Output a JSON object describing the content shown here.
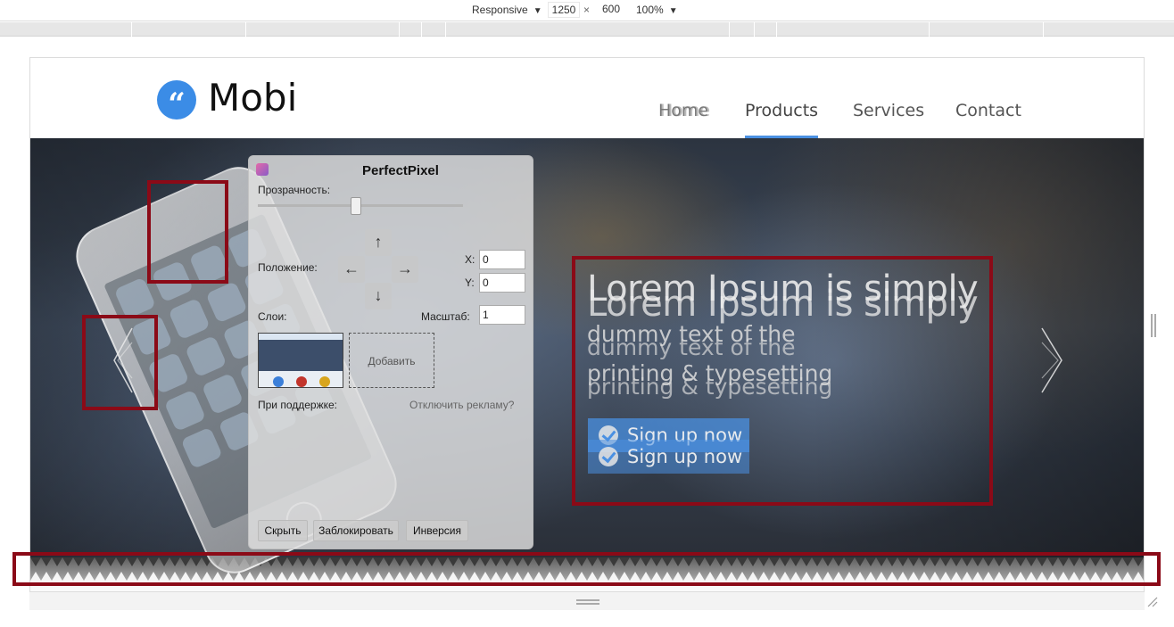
{
  "devtools": {
    "device_mode": "Responsive",
    "width": "1250",
    "times": "×",
    "height": "600",
    "zoom": "100%",
    "caret": "▼"
  },
  "site": {
    "logo_glyph": "“",
    "logo_text": "Mobi",
    "nav": {
      "home": "Home",
      "products": "Products",
      "services": "Services",
      "contact": "Contact"
    },
    "hero": {
      "headline": "Lorem Ipsum is simply",
      "sub_line1": "dummy text of the",
      "sub_line2": "printing & typesetting",
      "cta": "Sign up now"
    },
    "accent_color": "#4a90e2"
  },
  "perfectpixel": {
    "title": "PerfectPixel",
    "opacity_label": "Прозрачность:",
    "position_label": "Положение:",
    "arrow_up": "↑",
    "arrow_down": "↓",
    "arrow_left": "←",
    "arrow_right": "→",
    "x_label": "X:",
    "x_value": "0",
    "y_label": "Y:",
    "y_value": "0",
    "layers_label": "Слои:",
    "scale_label": "Масштаб:",
    "scale_value": "1",
    "add_label": "Добавить",
    "support_label": "При поддержке:",
    "disable_ads": "Отключить рекламу?",
    "btn_hide": "Скрыть",
    "btn_lock": "Заблокировать",
    "btn_invert": "Инверсия"
  },
  "highlight_color": "#8b0a17"
}
